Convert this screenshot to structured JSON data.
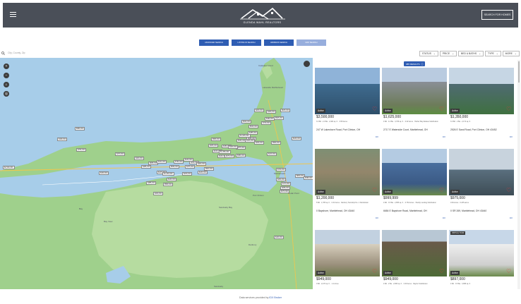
{
  "header": {
    "brand": "GLENDA WAHL REALTORS",
    "search_homes": "SEARCH FOR HOMES"
  },
  "tabs": [
    "ADVANCED SEARCH",
    "LISTING ID SEARCH",
    "ADDRESS SEARCH",
    "MAP SEARCH"
  ],
  "search": {
    "placeholder": "City, County, Zip"
  },
  "filters": [
    {
      "label": "STATUS"
    },
    {
      "label": "PRICE"
    },
    {
      "label": "BED & BATHS"
    },
    {
      "label": "TYPE"
    },
    {
      "label": "MORE"
    }
  ],
  "results_badge": "385 RESULTS",
  "listings": [
    {
      "status": "Active",
      "price": "$3,500,000",
      "details": "3.0 Bd · 2.0 Ba · 2,400 sq. ft. · 0.58 Acres",
      "address": "247 W Lakeshore Road, Port Clinton, OH",
      "idx": "IDX"
    },
    {
      "status": "Active",
      "price": "$1,625,000",
      "details": "4 Bd · 4.0 Ba · 3,736 sq. ft. · 0.32 Acres · Harbor Bay Estates Subdivision",
      "address": "2717 E Waterside Court, Marblehead, OH",
      "idx": "IDX"
    },
    {
      "status": "Active",
      "price": "$1,350,000",
      "details": "3.0 Bd · 2 Ba · 2,172 sq. ft.",
      "address": "2526 E Sand Road, Port Clinton, OH 43452",
      "idx": "IDX"
    },
    {
      "status": "Active",
      "price": "$1,200,000",
      "details": "5 Bd · 1,785 sq. ft. · 0.34 Acres · Danbury Township No. 1 Subdivision",
      "address": "0 Bayshore, Marblehead, OH 43440",
      "idx": "IDX"
    },
    {
      "status": "Active",
      "price": "$999,999",
      "details": "4 Bd · 3.5 Ba · 2,655 sq. ft. · 0.763 Acres · Shelby Landing Subdivision",
      "address": "6684 E Bayshore Road, Marblehead, OH",
      "idx": "IDX"
    },
    {
      "status": "Active",
      "price": "$975,000",
      "details": "0.84 Acres · 0.235 acres",
      "address": "0 SR 269, Marblehead, OH 43440",
      "idx": "IDX"
    },
    {
      "status": "Active",
      "price": "$949,000",
      "details": "3 Bd · 2,470 sq. ft. · 1.4 Acres",
      "address": "",
      "idx": ""
    },
    {
      "status": "Active",
      "price": "$949,000",
      "details": "4 Bd · 2 Ba · 2,836 sq. ft. · 0.39 Acres · Dayton Subdivision",
      "address": "",
      "idx": ""
    },
    {
      "status": "Active",
      "price": "$897,000",
      "details": "4 Bd · 3.5 Ba · 3,958 sq. ft.",
      "address": "",
      "idx": "",
      "virtual_tour": "VIRTUAL TOUR"
    }
  ],
  "map_pins": [
    {
      "t": "$2,500,000"
    },
    {
      "t": "$199,000"
    },
    {
      "t": "$589,000"
    },
    {
      "t": "$750,000"
    },
    {
      "t": "$349,900"
    },
    {
      "t": "$479,900"
    },
    {
      "t": "$409,900"
    },
    {
      "t": "$385,000"
    },
    {
      "t": "$689,000"
    },
    {
      "t": "$310,000"
    },
    {
      "t": "$799,000"
    },
    {
      "t": "$559,000"
    },
    {
      "t": "$475,000"
    },
    {
      "t": "$299,000"
    },
    {
      "t": "$400,000"
    },
    {
      "t": "$249,000"
    },
    {
      "t": "$229,000"
    },
    {
      "t": "$1,350,000"
    },
    {
      "t": "$449,000"
    },
    {
      "t": "$379,000"
    },
    {
      "t": "$975,000"
    },
    {
      "t": "$589,000"
    },
    {
      "t": "$359,000"
    },
    {
      "t": "$429,000"
    },
    {
      "t": "$339,000"
    },
    {
      "t": "$365,000"
    },
    {
      "t": "$285,000"
    },
    {
      "t": "$549,000"
    },
    {
      "t": "$209,000"
    },
    {
      "t": "$499,000"
    },
    {
      "t": "$469,000"
    },
    {
      "t": "$625,000"
    },
    {
      "t": "$525,000"
    },
    {
      "t": "$749,900"
    },
    {
      "t": "$320,000"
    },
    {
      "t": "$1,625,000"
    },
    {
      "t": "$315,000"
    },
    {
      "t": "$269,000"
    },
    {
      "t": "$219,000"
    },
    {
      "t": "$599,900"
    },
    {
      "t": "$249,000"
    },
    {
      "t": "$249,900"
    },
    {
      "t": "$215,000"
    },
    {
      "t": "$449,000"
    },
    {
      "t": "$599,000"
    },
    {
      "t": "$385,000"
    },
    {
      "t": "$349,900"
    },
    {
      "t": "$1,200,000"
    },
    {
      "t": "$749,000"
    },
    {
      "t": "$299,900"
    },
    {
      "t": "$289,000"
    },
    {
      "t": "$849,000"
    },
    {
      "t": "$398,000"
    },
    {
      "t": "$179,900"
    },
    {
      "t": "$379,900"
    },
    {
      "t": "$449,900"
    },
    {
      "t": "$249,000"
    },
    {
      "t": "$500,000"
    },
    {
      "t": "$325,000"
    },
    {
      "t": "$589,900"
    }
  ],
  "map_labels": [
    "Catawba Island",
    "Lakeside Marblehead",
    "Marblehead",
    "Port Clinton",
    "Danbury",
    "Sandusky Bay",
    "Bay",
    "Bay View",
    "Sandusky",
    "Castalia",
    "Cedar Point"
  ],
  "footer": {
    "prefix": "Data services provided by",
    "link": "IDX Broker"
  }
}
